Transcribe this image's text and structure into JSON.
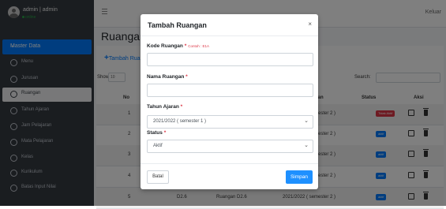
{
  "sidebar": {
    "user_name": "admin | admin",
    "user_status": "online",
    "section": "Master Data",
    "items": [
      {
        "label": "Menu",
        "active": false
      },
      {
        "label": "Jurusan",
        "active": false
      },
      {
        "label": "Ruangan",
        "active": true
      },
      {
        "label": "Tahun Ajaran",
        "active": false
      },
      {
        "label": "Jam Pelajaran",
        "active": false
      },
      {
        "label": "Mata Pelajaran",
        "active": false
      },
      {
        "label": "Kelas",
        "active": false
      },
      {
        "label": "Kurikulum",
        "active": false
      },
      {
        "label": "Batas Input Nilai",
        "active": false
      }
    ]
  },
  "topbar": {
    "logout": "Keluar"
  },
  "page": {
    "title": "Ruangan",
    "add_button": "Tambah Ruangan",
    "show_label": "Show",
    "show_value": "10",
    "search_label": "Search:"
  },
  "table": {
    "headers": {
      "no": "No",
      "tahun": "Tahun Ajaran",
      "status": "Status",
      "aksi": "Aksi"
    },
    "rows": [
      {
        "no": "1",
        "kode": "",
        "nama": "",
        "tahun": "2021/2022 ( semester 2 )",
        "status": "Tidak Aktif",
        "status_color": "#dc3545"
      },
      {
        "no": "2",
        "kode": "",
        "nama": "",
        "tahun": "2021/2022 ( semester 2 )",
        "status": "aktif",
        "status_color": "#007bff"
      },
      {
        "no": "3",
        "kode": "",
        "nama": "",
        "tahun": "2021/2022 ( semester 2 )",
        "status": "aktif",
        "status_color": "#007bff"
      },
      {
        "no": "4",
        "kode": "",
        "nama": "",
        "tahun": "2021/2022 ( semester 2 )",
        "status": "aktif",
        "status_color": "#007bff"
      },
      {
        "no": "5",
        "kode": "D2.6",
        "nama": "Ruangan D2.6",
        "tahun": "2021/2022 ( semester 2 )",
        "status": "aktif",
        "status_color": "#007bff"
      }
    ]
  },
  "modal": {
    "title": "Tambah Ruangan",
    "kode_label": "Kode Ruangan",
    "kode_hint": "Contoh : E1A",
    "kode_value": "",
    "nama_label": "Nama Ruangan",
    "nama_value": "",
    "tahun_label": "Tahun Ajaran",
    "tahun_value": "2021/2022 ( semester 1 )",
    "status_label": "Status",
    "status_value": "Aktif",
    "cancel": "Batal",
    "save": "Simpan"
  },
  "colors": {
    "primary": "#007bff",
    "danger": "#dc3545",
    "sidebar": "#343a40"
  }
}
